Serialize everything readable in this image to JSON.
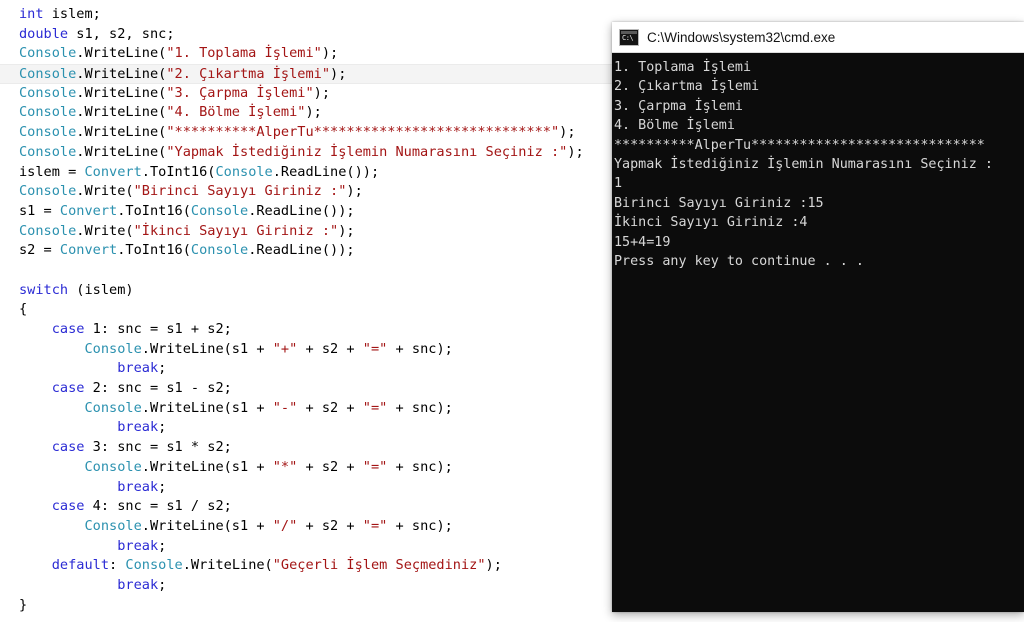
{
  "editor": {
    "name": "code-editor",
    "language": "csharp",
    "current_line_index": 3,
    "colors": {
      "background": "#ffffff",
      "keyword": "#2b2bd4",
      "type": "#2b91af",
      "string": "#a31515",
      "plain": "#000000",
      "current_line_highlight": "#f4f4f4"
    },
    "lines": [
      [
        {
          "t": "int",
          "c": "kw"
        },
        {
          "t": " islem;",
          "c": "pl"
        }
      ],
      [
        {
          "t": "double",
          "c": "kw"
        },
        {
          "t": " s1, s2, snc;",
          "c": "pl"
        }
      ],
      [
        {
          "t": "Console",
          "c": "type"
        },
        {
          "t": ".WriteLine(",
          "c": "pl"
        },
        {
          "t": "\"1. Toplama İşlemi\"",
          "c": "str"
        },
        {
          "t": ");",
          "c": "pl"
        }
      ],
      [
        {
          "t": "Console",
          "c": "type"
        },
        {
          "t": ".WriteLine(",
          "c": "pl"
        },
        {
          "t": "\"2. Çıkartma İşlemi\"",
          "c": "str"
        },
        {
          "t": ");",
          "c": "pl"
        }
      ],
      [
        {
          "t": "Console",
          "c": "type"
        },
        {
          "t": ".WriteLine(",
          "c": "pl"
        },
        {
          "t": "\"3. Çarpma İşlemi\"",
          "c": "str"
        },
        {
          "t": ");",
          "c": "pl"
        }
      ],
      [
        {
          "t": "Console",
          "c": "type"
        },
        {
          "t": ".WriteLine(",
          "c": "pl"
        },
        {
          "t": "\"4. Bölme İşlemi\"",
          "c": "str"
        },
        {
          "t": ");",
          "c": "pl"
        }
      ],
      [
        {
          "t": "Console",
          "c": "type"
        },
        {
          "t": ".WriteLine(",
          "c": "pl"
        },
        {
          "t": "\"**********AlperTu*****************************\"",
          "c": "str"
        },
        {
          "t": ");",
          "c": "pl"
        }
      ],
      [
        {
          "t": "Console",
          "c": "type"
        },
        {
          "t": ".WriteLine(",
          "c": "pl"
        },
        {
          "t": "\"Yapmak İstediğiniz İşlemin Numarasını Seçiniz :\"",
          "c": "str"
        },
        {
          "t": ");",
          "c": "pl"
        }
      ],
      [
        {
          "t": "islem = ",
          "c": "pl"
        },
        {
          "t": "Convert",
          "c": "type"
        },
        {
          "t": ".ToInt16(",
          "c": "pl"
        },
        {
          "t": "Console",
          "c": "type"
        },
        {
          "t": ".ReadLine());",
          "c": "pl"
        }
      ],
      [
        {
          "t": "Console",
          "c": "type"
        },
        {
          "t": ".Write(",
          "c": "pl"
        },
        {
          "t": "\"Birinci Sayıyı Giriniz :\"",
          "c": "str"
        },
        {
          "t": ");",
          "c": "pl"
        }
      ],
      [
        {
          "t": "s1 = ",
          "c": "pl"
        },
        {
          "t": "Convert",
          "c": "type"
        },
        {
          "t": ".ToInt16(",
          "c": "pl"
        },
        {
          "t": "Console",
          "c": "type"
        },
        {
          "t": ".ReadLine());",
          "c": "pl"
        }
      ],
      [
        {
          "t": "Console",
          "c": "type"
        },
        {
          "t": ".Write(",
          "c": "pl"
        },
        {
          "t": "\"İkinci Sayıyı Giriniz :\"",
          "c": "str"
        },
        {
          "t": ");",
          "c": "pl"
        }
      ],
      [
        {
          "t": "s2 = ",
          "c": "pl"
        },
        {
          "t": "Convert",
          "c": "type"
        },
        {
          "t": ".ToInt16(",
          "c": "pl"
        },
        {
          "t": "Console",
          "c": "type"
        },
        {
          "t": ".ReadLine());",
          "c": "pl"
        }
      ],
      [],
      [
        {
          "t": "switch",
          "c": "kw"
        },
        {
          "t": " (islem)",
          "c": "pl"
        }
      ],
      [
        {
          "t": "{",
          "c": "pl"
        }
      ],
      [
        {
          "t": "    ",
          "c": "pl"
        },
        {
          "t": "case",
          "c": "kw"
        },
        {
          "t": " 1: snc = s1 + s2;",
          "c": "pl"
        }
      ],
      [
        {
          "t": "        ",
          "c": "pl"
        },
        {
          "t": "Console",
          "c": "type"
        },
        {
          "t": ".WriteLine(s1 + ",
          "c": "pl"
        },
        {
          "t": "\"+\"",
          "c": "str"
        },
        {
          "t": " + s2 + ",
          "c": "pl"
        },
        {
          "t": "\"=\"",
          "c": "str"
        },
        {
          "t": " + snc);",
          "c": "pl"
        }
      ],
      [
        {
          "t": "            ",
          "c": "pl"
        },
        {
          "t": "break",
          "c": "kw"
        },
        {
          "t": ";",
          "c": "pl"
        }
      ],
      [
        {
          "t": "    ",
          "c": "pl"
        },
        {
          "t": "case",
          "c": "kw"
        },
        {
          "t": " 2: snc = s1 - s2;",
          "c": "pl"
        }
      ],
      [
        {
          "t": "        ",
          "c": "pl"
        },
        {
          "t": "Console",
          "c": "type"
        },
        {
          "t": ".WriteLine(s1 + ",
          "c": "pl"
        },
        {
          "t": "\"-\"",
          "c": "str"
        },
        {
          "t": " + s2 + ",
          "c": "pl"
        },
        {
          "t": "\"=\"",
          "c": "str"
        },
        {
          "t": " + snc);",
          "c": "pl"
        }
      ],
      [
        {
          "t": "            ",
          "c": "pl"
        },
        {
          "t": "break",
          "c": "kw"
        },
        {
          "t": ";",
          "c": "pl"
        }
      ],
      [
        {
          "t": "    ",
          "c": "pl"
        },
        {
          "t": "case",
          "c": "kw"
        },
        {
          "t": " 3: snc = s1 * s2;",
          "c": "pl"
        }
      ],
      [
        {
          "t": "        ",
          "c": "pl"
        },
        {
          "t": "Console",
          "c": "type"
        },
        {
          "t": ".WriteLine(s1 + ",
          "c": "pl"
        },
        {
          "t": "\"*\"",
          "c": "str"
        },
        {
          "t": " + s2 + ",
          "c": "pl"
        },
        {
          "t": "\"=\"",
          "c": "str"
        },
        {
          "t": " + snc);",
          "c": "pl"
        }
      ],
      [
        {
          "t": "            ",
          "c": "pl"
        },
        {
          "t": "break",
          "c": "kw"
        },
        {
          "t": ";",
          "c": "pl"
        }
      ],
      [
        {
          "t": "    ",
          "c": "pl"
        },
        {
          "t": "case",
          "c": "kw"
        },
        {
          "t": " 4: snc = s1 / s2;",
          "c": "pl"
        }
      ],
      [
        {
          "t": "        ",
          "c": "pl"
        },
        {
          "t": "Console",
          "c": "type"
        },
        {
          "t": ".WriteLine(s1 + ",
          "c": "pl"
        },
        {
          "t": "\"/\"",
          "c": "str"
        },
        {
          "t": " + s2 + ",
          "c": "pl"
        },
        {
          "t": "\"=\"",
          "c": "str"
        },
        {
          "t": " + snc);",
          "c": "pl"
        }
      ],
      [
        {
          "t": "            ",
          "c": "pl"
        },
        {
          "t": "break",
          "c": "kw"
        },
        {
          "t": ";",
          "c": "pl"
        }
      ],
      [
        {
          "t": "    ",
          "c": "pl"
        },
        {
          "t": "default",
          "c": "kw"
        },
        {
          "t": ": ",
          "c": "pl"
        },
        {
          "t": "Console",
          "c": "type"
        },
        {
          "t": ".WriteLine(",
          "c": "pl"
        },
        {
          "t": "\"Geçerli İşlem Seçmediniz\"",
          "c": "str"
        },
        {
          "t": ");",
          "c": "pl"
        }
      ],
      [
        {
          "t": "            ",
          "c": "pl"
        },
        {
          "t": "break",
          "c": "kw"
        },
        {
          "t": ";",
          "c": "pl"
        }
      ],
      [
        {
          "t": "}",
          "c": "pl"
        }
      ]
    ]
  },
  "console_window": {
    "title": "C:\\Windows\\system32\\cmd.exe",
    "icon": "cmd-icon",
    "background": "#0c0c0c",
    "foreground": "#d8d8d8",
    "output_lines": [
      "1. Toplama İşlemi",
      "2. Çıkartma İşlemi",
      "3. Çarpma İşlemi",
      "4. Bölme İşlemi",
      "**********AlperTu*****************************",
      "Yapmak İstediğiniz İşlemin Numarasını Seçiniz :",
      "1",
      "Birinci Sayıyı Giriniz :15",
      "İkinci Sayıyı Giriniz :4",
      "15+4=19",
      "Press any key to continue . . ."
    ]
  }
}
